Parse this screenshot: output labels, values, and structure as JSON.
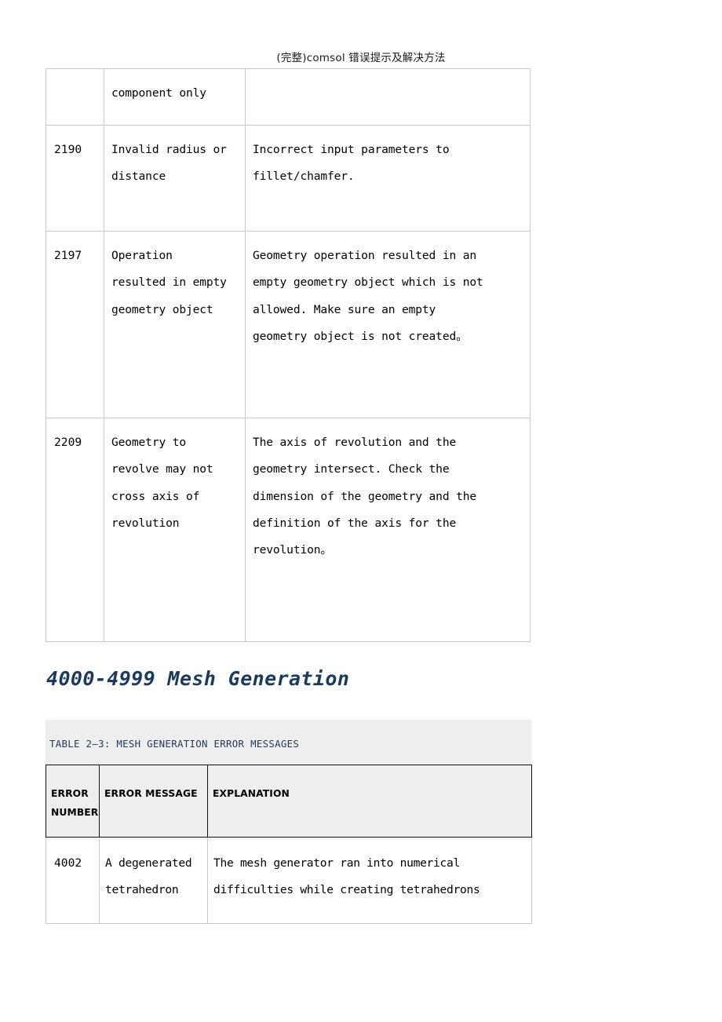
{
  "document": {
    "running_header": "(完整)comsol 错误提示及解决方法"
  },
  "geometry_table": {
    "name": "geometry-error-messages-continued",
    "rows": [
      {
        "error_number": "",
        "error_message": "component only",
        "explanation": ""
      },
      {
        "error_number": "2190",
        "error_message": "Invalid radius or\ndistance",
        "explanation": "Incorrect input parameters to\nfillet/chamfer."
      },
      {
        "error_number": "2197",
        "error_message": "Operation\nresulted in empty\ngeometry object",
        "explanation": "Geometry operation resulted in an\nempty geometry object which is not\nallowed. Make sure an empty\ngeometry object is not created。"
      },
      {
        "error_number": "2209",
        "error_message": "Geometry to\nrevolve may not\ncross axis of\nrevolution",
        "explanation": "The axis of revolution and the\ngeometry intersect. Check the\ndimension of the geometry and the\ndefinition of the axis for the\nrevolution。"
      }
    ]
  },
  "section": {
    "heading": "4000-4999 Mesh Generation"
  },
  "mesh_table": {
    "caption": "TABLE 2—3: MESH GENERATION ERROR MESSAGES",
    "headers": {
      "error_number": "ERROR\nNUMBER",
      "error_message": "ERROR MESSAGE",
      "explanation": "EXPLANATION"
    },
    "rows": [
      {
        "error_number": "4002",
        "error_message": "A degenerated\ntetrahedron",
        "explanation": "The mesh generator ran into numerical\ndifficulties while creating tetrahedrons"
      }
    ]
  },
  "colors": {
    "heading": "#1b3a5c",
    "caption_text": "#1b3a5c",
    "caption_bg": "#eeeeee",
    "table_border_light": "#c9c9c9",
    "table_border_dark": "#111111"
  }
}
